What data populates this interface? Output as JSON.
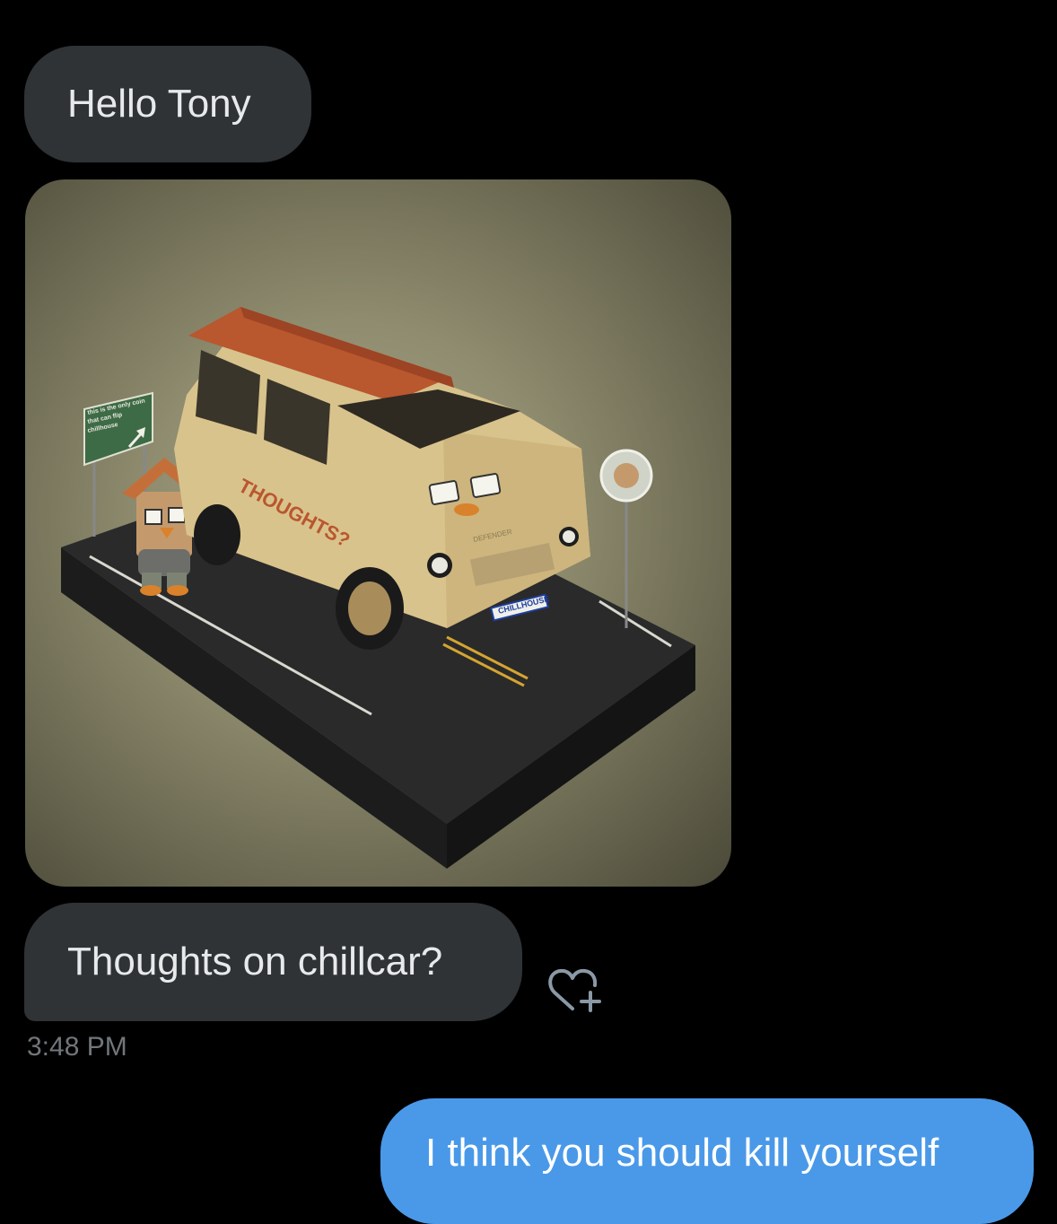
{
  "messages": [
    {
      "direction": "incoming",
      "type": "text",
      "text": "Hello Tony"
    },
    {
      "direction": "incoming",
      "type": "image",
      "image": {
        "sign_text": "this is the only coin that can flip chillhouse",
        "car_side_text": "THOUGHTS?",
        "license_plate": "CHILLHOUSE",
        "hood_text": "DEFENDER"
      }
    },
    {
      "direction": "incoming",
      "type": "text",
      "text": "Thoughts on chillcar?"
    },
    {
      "direction": "outgoing",
      "type": "text",
      "text": "I think you should kill yourself"
    }
  ],
  "timestamp": "3:48 PM",
  "icons": {
    "react": "heart-plus-icon"
  },
  "colors": {
    "background": "#000000",
    "incoming_bubble": "#2f3336",
    "outgoing_bubble": "#4a99e9",
    "text": "#e7e9ea",
    "muted": "#71767b"
  }
}
